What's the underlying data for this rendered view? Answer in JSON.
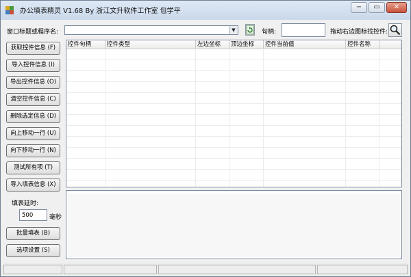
{
  "window": {
    "title": "办公填表精灵 V1.68 By 浙江文升软件工作室 包学平",
    "minimize_glyph": "−",
    "maximize_glyph": "▭",
    "close_glyph": "✕"
  },
  "toolbar": {
    "window_label": "窗口标题或程序名:",
    "window_value": "",
    "handle_label": "句柄:",
    "handle_value": "",
    "drag_label": "拖动右边图标找控件:"
  },
  "buttons": {
    "get_info": "获取控件信息 (F)",
    "import_info": "导入控件信息 (I)",
    "export_info": "导出控件信息 (O)",
    "clear_info": "清空控件信息 (C)",
    "delete_selected": "删除选定信息 (D)",
    "move_up": "向上移动一行 (U)",
    "move_down": "向下移动一行 (N)",
    "test_all": "测试所有项 (T)",
    "import_fill": "导入填表信息 (X)",
    "batch_fill": "批量填表 (B)",
    "options": "选项设置 (S)"
  },
  "delay": {
    "label": "填表延时:",
    "value": "500",
    "unit": "毫秒"
  },
  "table": {
    "columns": [
      "控件句柄",
      "控件类型",
      "左边坐标",
      "顶边坐标",
      "控件当前值",
      "控件名称"
    ],
    "rows": []
  },
  "status": {
    "segments": [
      "",
      "",
      "",
      ""
    ]
  },
  "colors": {
    "title_bar": "#c9d8ea",
    "window_bg": "#f0f0f0",
    "close_button": "#c8523a"
  }
}
